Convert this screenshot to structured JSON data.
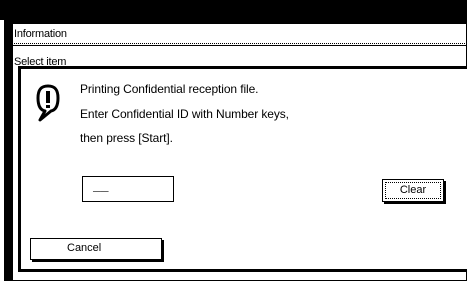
{
  "window": {
    "title": "Information",
    "subtitle": "Select item"
  },
  "dialog": {
    "icon": "info-icon",
    "message_lines": [
      "Printing Confidential reception file.",
      "Enter Confidential ID with Number keys,",
      "then press [Start]."
    ],
    "id_field_value": "__",
    "clear_label": "Clear",
    "cancel_label": "Cancel"
  }
}
